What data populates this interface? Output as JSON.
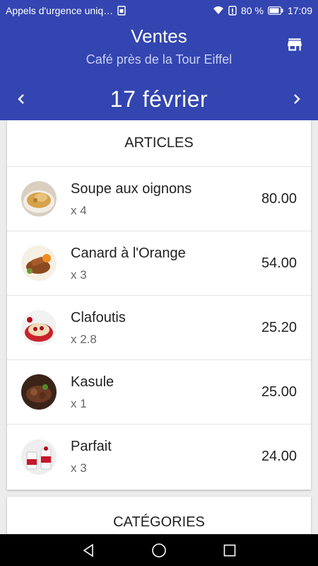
{
  "status_bar": {
    "notification": "Appels d'urgence uniq…",
    "battery": "80 %",
    "time": "17:09"
  },
  "header": {
    "title": "Ventes",
    "subtitle": "Café près de la Tour Eiffel",
    "date": "17  février"
  },
  "articles": {
    "heading": "ARTICLES",
    "items": [
      {
        "name": "Soupe aux oignons",
        "qty": "x 4",
        "price": "80.00"
      },
      {
        "name": "Canard à l'Orange",
        "qty": "x 3",
        "price": "54.00"
      },
      {
        "name": "Clafoutis",
        "qty": "x 2.8",
        "price": "25.20"
      },
      {
        "name": "Kasule",
        "qty": "x 1",
        "price": "25.00"
      },
      {
        "name": "Parfait",
        "qty": "x 3",
        "price": "24.00"
      }
    ]
  },
  "categories": {
    "heading": "CATÉGORIES"
  },
  "colors": {
    "primary": "#3345b0",
    "subtitle": "#c9d0f5"
  }
}
